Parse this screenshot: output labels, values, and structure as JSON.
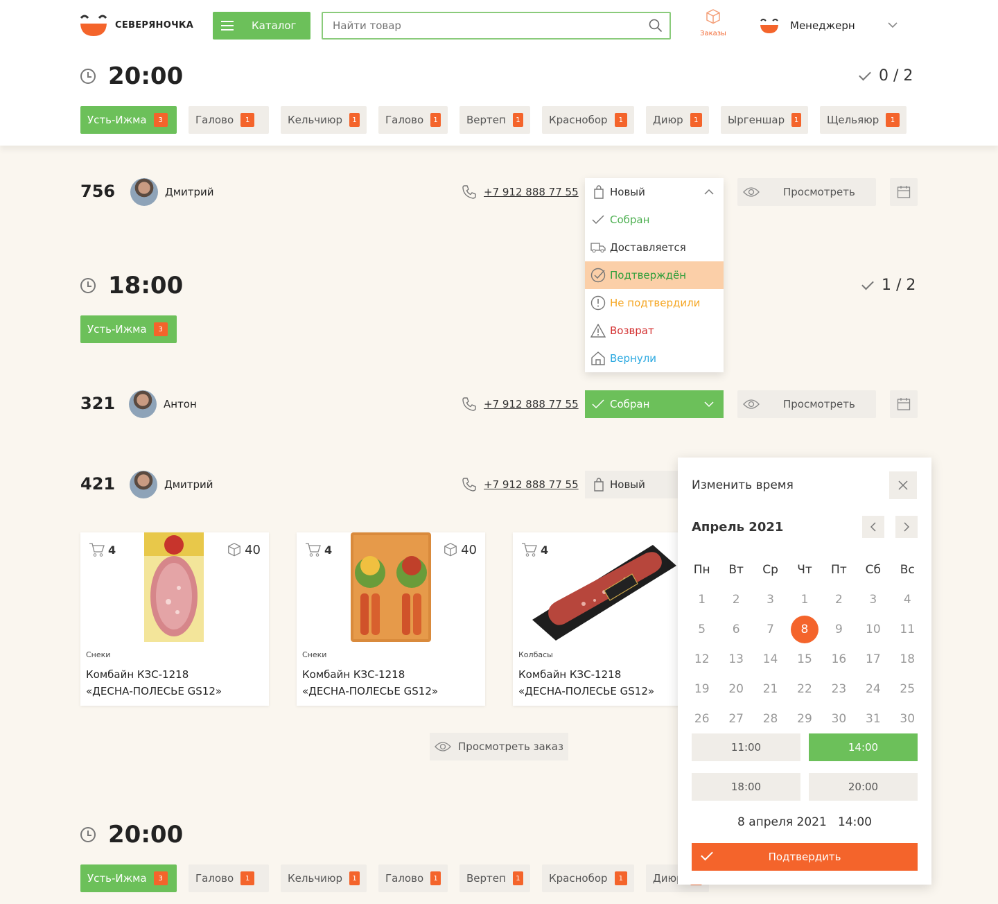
{
  "header": {
    "brand": "СЕВЕРЯНОЧКА",
    "catalog_label": "Каталог",
    "search_placeholder": "Найти товар",
    "orders_label": "Заказы",
    "manager_name": "Менеджерн",
    "accent": "#6cc05a",
    "brand_orange": "#f4642b"
  },
  "groups": [
    {
      "time": "20:00",
      "counter": "0 / 2",
      "tags": [
        {
          "label": "Усть-Ижма",
          "count": "3",
          "active": true
        },
        {
          "label": "Галово",
          "count": "1"
        },
        {
          "label": "Кельчиюр",
          "count": "1"
        },
        {
          "label": "Галово",
          "count": "1"
        },
        {
          "label": "Вертеп",
          "count": "1"
        },
        {
          "label": "Краснобор",
          "count": "1"
        },
        {
          "label": "Диюр",
          "count": "1"
        },
        {
          "label": "Ыргеншар",
          "count": "1"
        },
        {
          "label": "Щельяюр",
          "count": "1"
        }
      ]
    },
    {
      "time": "18:00",
      "counter": "1 / 2",
      "tags": [
        {
          "label": "Усть-Ижма",
          "count": "3",
          "active": true
        }
      ]
    },
    {
      "time": "20:00",
      "tags": [
        {
          "label": "Усть-Ижма",
          "count": "3",
          "active": true
        },
        {
          "label": "Галово",
          "count": "1"
        },
        {
          "label": "Кельчиюр",
          "count": "1"
        },
        {
          "label": "Галово",
          "count": "1"
        },
        {
          "label": "Вертеп",
          "count": "1"
        },
        {
          "label": "Краснобор",
          "count": "1"
        },
        {
          "label": "Диюр",
          "count": "1"
        }
      ]
    }
  ],
  "orders": [
    {
      "number": "756",
      "name": "Дмитрий",
      "phone": "+7 912 888 77 55",
      "status": "Новый",
      "view": "Просмотреть"
    },
    {
      "number": "321",
      "name": "Антон",
      "phone": "+7 912 888 77 55",
      "status": "Собран",
      "view": "Просмотреть"
    },
    {
      "number": "421",
      "name": "Дмитрий",
      "phone": "+7 912 888 77 55",
      "status": "Новый"
    }
  ],
  "status_menu": [
    {
      "label": "Собран",
      "color": "#4caf50"
    },
    {
      "label": "Доставляется",
      "color": "#333333"
    },
    {
      "label": "Подтверждён",
      "color": "#2e9e3a"
    },
    {
      "label": "Не подтвердили",
      "color": "#f5a623"
    },
    {
      "label": "Возврат",
      "color": "#d32f2f"
    },
    {
      "label": "Вернули",
      "color": "#29a8e0"
    }
  ],
  "products": [
    {
      "cart": "4",
      "stock": "40",
      "category": "Снеки",
      "title_line1": "Комбайн КЗС-1218",
      "title_line2": "«ДЕСНА-ПОЛЕСЬЕ GS12»"
    },
    {
      "cart": "4",
      "stock": "40",
      "category": "Снеки",
      "title_line1": "Комбайн КЗС-1218",
      "title_line2": "«ДЕСНА-ПОЛЕСЬЕ GS12»"
    },
    {
      "cart": "4",
      "category": "Колбасы",
      "title_line1": "Комбайн КЗС-1218",
      "title_line2": "«ДЕСНА-ПОЛЕСЬЕ GS12»"
    }
  ],
  "view_order_label": "Просмотреть заказ",
  "calendar": {
    "title": "Изменить время",
    "month": "Апрель 2021",
    "weekdays": [
      "Пн",
      "Вт",
      "Ср",
      "Чт",
      "Пт",
      "Сб",
      "Вс"
    ],
    "weeks": [
      [
        "1",
        "2",
        "3",
        "1",
        "2",
        "3",
        "4"
      ],
      [
        "5",
        "6",
        "7",
        "8",
        "9",
        "10",
        "11"
      ],
      [
        "12",
        "13",
        "14",
        "15",
        "16",
        "17",
        "18"
      ],
      [
        "19",
        "20",
        "21",
        "22",
        "23",
        "24",
        "25"
      ],
      [
        "26",
        "27",
        "28",
        "29",
        "30",
        "31",
        "30"
      ]
    ],
    "selected_day": "8",
    "slots": [
      "11:00",
      "14:00",
      "18:00",
      "20:00"
    ],
    "active_slot": "14:00",
    "summary_date": "8 апреля 2021",
    "summary_time": "14:00",
    "confirm_label": "Подтвердить"
  }
}
